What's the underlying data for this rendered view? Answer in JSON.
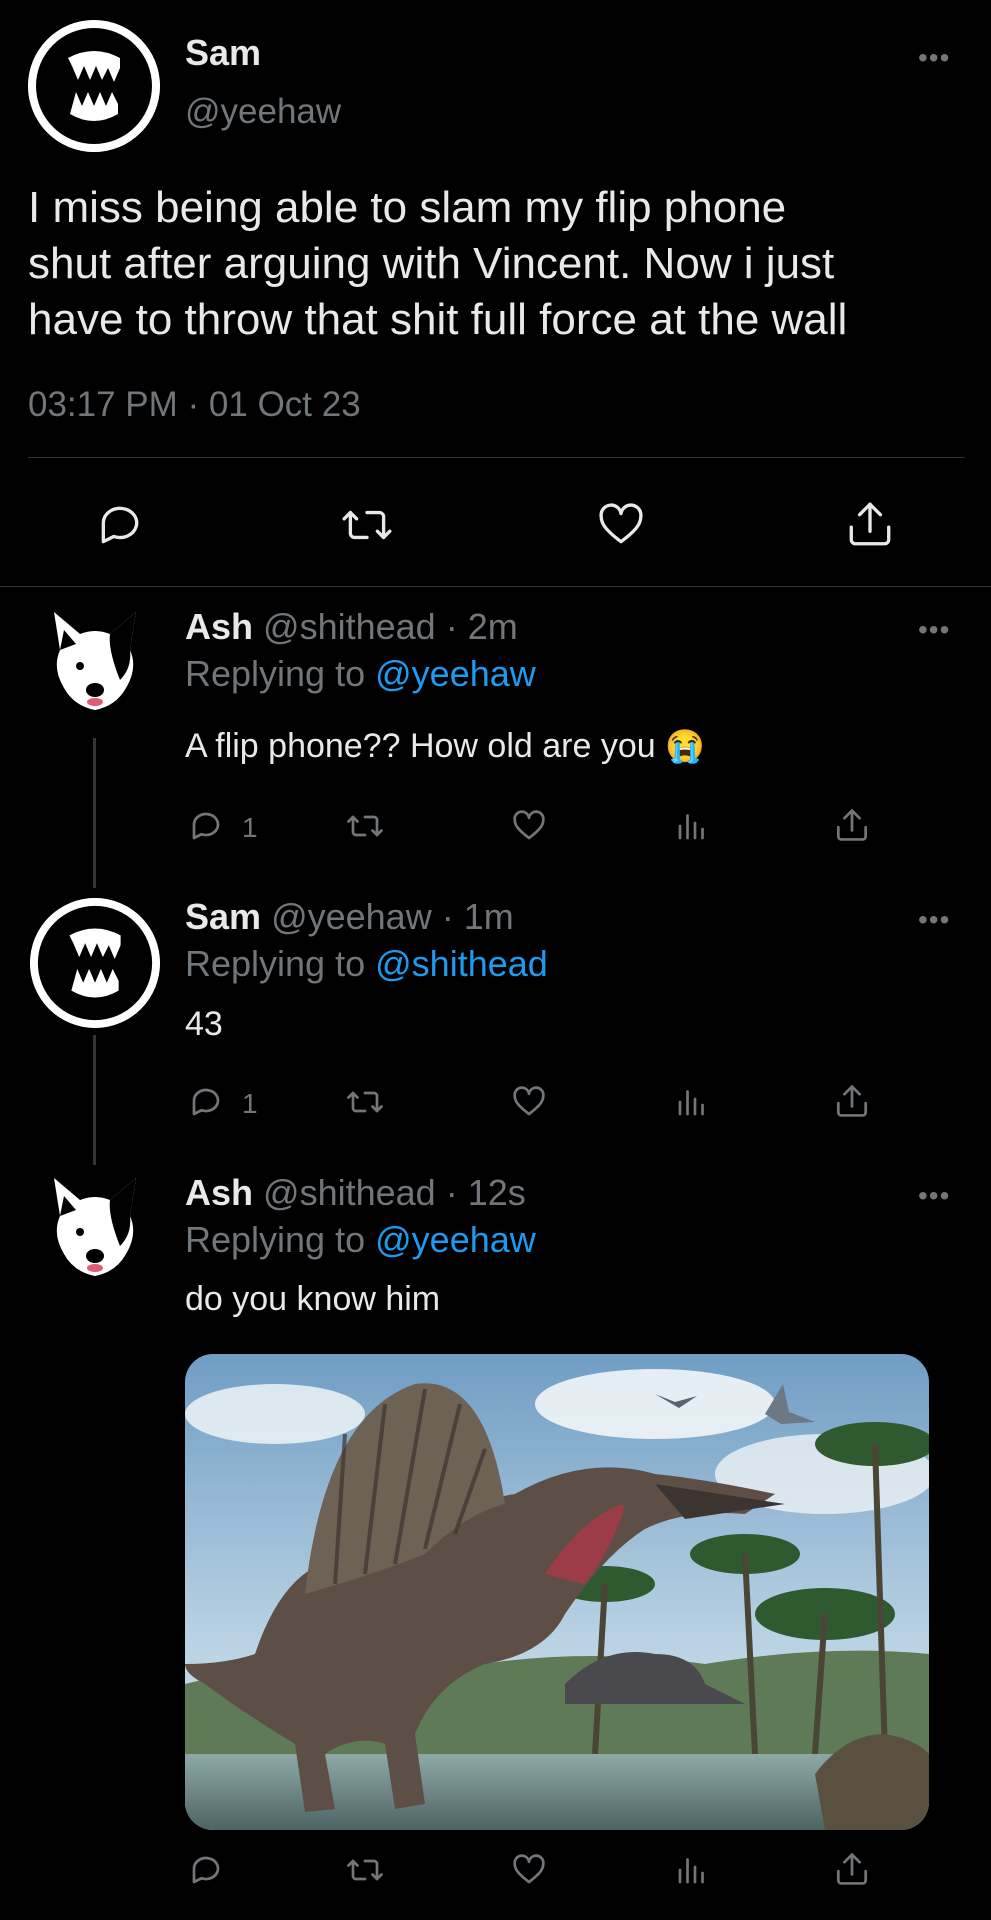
{
  "main_tweet": {
    "author_name": "Sam",
    "author_handle": "@yeehaw",
    "text_lines": [
      "I miss being able to slam my flip phone",
      "shut after arguing with Vincent. Now i just",
      "have to throw that shit full force at the wall"
    ],
    "timestamp": "03:17 PM · 01 Oct 23",
    "actions": [
      "reply-icon",
      "retweet-icon",
      "like-icon",
      "share-icon"
    ]
  },
  "replies": [
    {
      "name": "Ash",
      "handle": "@shithead",
      "time": "· 2m",
      "replying_label": "Replying to",
      "replying_to": "@yeehaw",
      "text": "A flip phone?? How old are you",
      "emoji": "😭",
      "reply_count": "1"
    },
    {
      "name": "Sam",
      "handle": "@yeehaw",
      "time": "· 1m",
      "replying_label": "Replying to",
      "replying_to": "@shithead",
      "text": "43",
      "reply_count": "1"
    },
    {
      "name": "Ash",
      "handle": "@shithead",
      "time": "· 12s",
      "replying_label": "Replying to",
      "replying_to": "@yeehaw",
      "text": "do you know him",
      "media": "spinosaurus-image"
    }
  ],
  "colors": {
    "background": "#000000",
    "text": "#e7e9ea",
    "muted": "#71767b",
    "link": "#1d9bf0",
    "divider": "#2f3336"
  }
}
